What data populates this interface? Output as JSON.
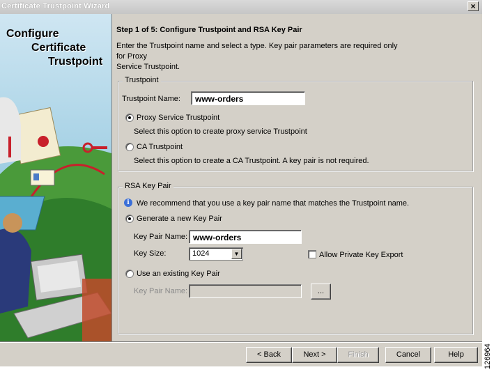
{
  "window": {
    "title": "Certificate Trustpoint Wizard"
  },
  "side_panel": {
    "line1": "Configure",
    "line2": "Certificate",
    "line3": "Trustpoint"
  },
  "step_title": "Step 1 of 5: Configure Trustpoint and RSA Key Pair",
  "intro": {
    "line1": "Enter the Trustpoint name and select a type. Key pair parameters are required only",
    "line2": "for Proxy",
    "line3": "Service Trustpoint."
  },
  "trustpoint_group": {
    "legend": "Trustpoint",
    "name_label": "Trustpoint Name:",
    "name_value": "www-orders",
    "proxy_label": "Proxy Service Trustpoint",
    "proxy_desc": "Select this option to create proxy service Trustpoint",
    "ca_label": "CA Trustpoint",
    "ca_desc": "Select this option to create a CA Trustpoint. A key pair is not required."
  },
  "rsa_group": {
    "legend": "RSA Key Pair",
    "info_text": "We recommend that you use a key pair name that matches the Trustpoint name.",
    "generate_label": "Generate a new Key Pair",
    "key_pair_name_label": "Key Pair Name:",
    "key_pair_name_value": "www-orders",
    "key_size_label": "Key Size:",
    "key_size_value": "1024",
    "allow_export_label": "Allow Private Key Export",
    "use_existing_label": "Use an existing Key Pair",
    "existing_name_label": "Key Pair Name:",
    "browse_label": "..."
  },
  "buttons": {
    "back": "< Back",
    "next": "Next >",
    "finish": "Finish",
    "cancel": "Cancel",
    "help": "Help"
  },
  "figure_number": "126964"
}
